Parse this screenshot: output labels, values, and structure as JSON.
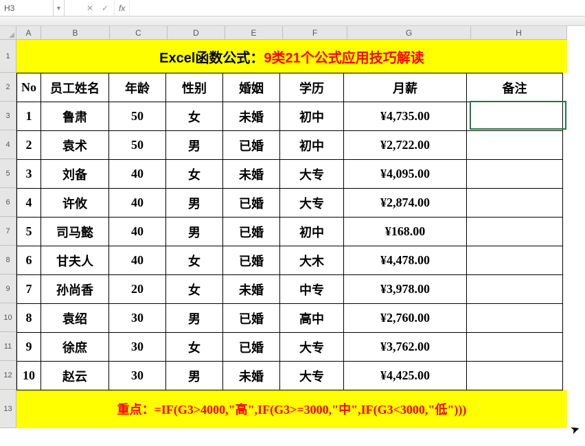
{
  "formula_bar": {
    "name_box": "H3",
    "cancel": "✕",
    "confirm": "✓",
    "fx_label": "fx",
    "formula_value": ""
  },
  "col_labels": [
    "A",
    "B",
    "C",
    "D",
    "E",
    "F",
    "G",
    "H"
  ],
  "row_labels": [
    "1",
    "2",
    "3",
    "4",
    "5",
    "6",
    "7",
    "8",
    "9",
    "10",
    "11",
    "12",
    "13"
  ],
  "title": {
    "prefix": "Excel函数公式：",
    "main": "9类21个公式应用技巧解读"
  },
  "headers": {
    "no": "No",
    "name": "员工姓名",
    "age": "年龄",
    "gender": "性别",
    "marriage": "婚姻",
    "education": "学历",
    "salary": "月薪",
    "note": "备注"
  },
  "rows": [
    {
      "no": "1",
      "name": "鲁肃",
      "age": "50",
      "gender": "女",
      "marriage": "未婚",
      "education": "初中",
      "salary": "¥4,735.00",
      "note": ""
    },
    {
      "no": "2",
      "name": "袁术",
      "age": "50",
      "gender": "男",
      "marriage": "已婚",
      "education": "初中",
      "salary": "¥2,722.00",
      "note": ""
    },
    {
      "no": "3",
      "name": "刘备",
      "age": "40",
      "gender": "女",
      "marriage": "未婚",
      "education": "大专",
      "salary": "¥4,095.00",
      "note": ""
    },
    {
      "no": "4",
      "name": "许攸",
      "age": "40",
      "gender": "男",
      "marriage": "已婚",
      "education": "大专",
      "salary": "¥2,874.00",
      "note": ""
    },
    {
      "no": "5",
      "name": "司马懿",
      "age": "40",
      "gender": "男",
      "marriage": "已婚",
      "education": "初中",
      "salary": "¥168.00",
      "note": ""
    },
    {
      "no": "6",
      "name": "甘夫人",
      "age": "40",
      "gender": "女",
      "marriage": "已婚",
      "education": "大木",
      "salary": "¥4,478.00",
      "note": ""
    },
    {
      "no": "7",
      "name": "孙尚香",
      "age": "20",
      "gender": "女",
      "marriage": "未婚",
      "education": "中专",
      "salary": "¥3,978.00",
      "note": ""
    },
    {
      "no": "8",
      "name": "袁绍",
      "age": "30",
      "gender": "男",
      "marriage": "已婚",
      "education": "高中",
      "salary": "¥2,760.00",
      "note": ""
    },
    {
      "no": "9",
      "name": "徐庶",
      "age": "30",
      "gender": "女",
      "marriage": "已婚",
      "education": "大专",
      "salary": "¥3,762.00",
      "note": ""
    },
    {
      "no": "10",
      "name": "赵云",
      "age": "30",
      "gender": "男",
      "marriage": "未婚",
      "education": "大专",
      "salary": "¥4,425.00",
      "note": ""
    }
  ],
  "footer": {
    "label": "重点：",
    "formula": "=IF(G3>4000,\"高\",IF(G3>=3000,\"中\",IF(G3<3000,\"低\")))"
  }
}
